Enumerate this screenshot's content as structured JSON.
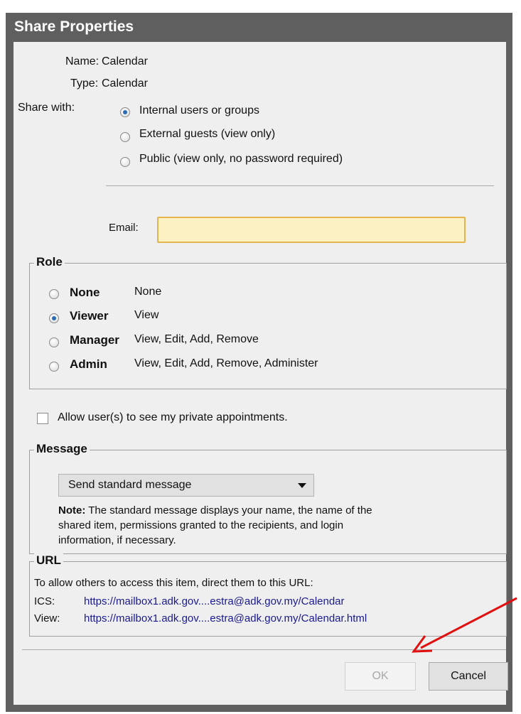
{
  "dialog": {
    "title": "Share Properties"
  },
  "properties": {
    "name_label": "Name:",
    "name_value": "Calendar",
    "type_label": "Type:",
    "type_value": "Calendar",
    "share_with_label": "Share with:",
    "share_options": [
      {
        "label": "Internal users or groups",
        "selected": true
      },
      {
        "label": "External guests (view only)",
        "selected": false
      },
      {
        "label": "Public (view only, no password required)",
        "selected": false
      }
    ],
    "email_label": "Email:",
    "email_value": ""
  },
  "role": {
    "legend": "Role",
    "options": [
      {
        "name": "None",
        "desc": "None",
        "selected": false
      },
      {
        "name": "Viewer",
        "desc": "View",
        "selected": true
      },
      {
        "name": "Manager",
        "desc": "View, Edit, Add, Remove",
        "selected": false
      },
      {
        "name": "Admin",
        "desc": "View, Edit, Add, Remove, Administer",
        "selected": false
      }
    ]
  },
  "private": {
    "label": "Allow user(s) to see my private appointments.",
    "checked": false
  },
  "message": {
    "legend": "Message",
    "selected": "Send standard message",
    "note_bold": "Note:",
    "note_line1": "The standard message displays your name, the name of the",
    "note_line2": "shared item, permissions granted to the recipients, and login",
    "note_line3": "information, if necessary."
  },
  "url": {
    "legend": "URL",
    "intro": "To allow others to access this item, direct them to this URL:",
    "ics_label": "ICS:",
    "ics_link": "https://mailbox1.adk.gov....estra@adk.gov.my/Calendar",
    "view_label": "View:",
    "view_link": "https://mailbox1.adk.gov....estra@adk.gov.my/Calendar.html"
  },
  "buttons": {
    "ok": "OK",
    "cancel": "Cancel"
  },
  "colors": {
    "titlebar": "#5f5f5f",
    "panel": "#efefef",
    "email_bg": "#fbf1c3",
    "email_border": "#e3b44f",
    "link": "#1a1a8e",
    "annotation_arrow": "#e01010"
  }
}
